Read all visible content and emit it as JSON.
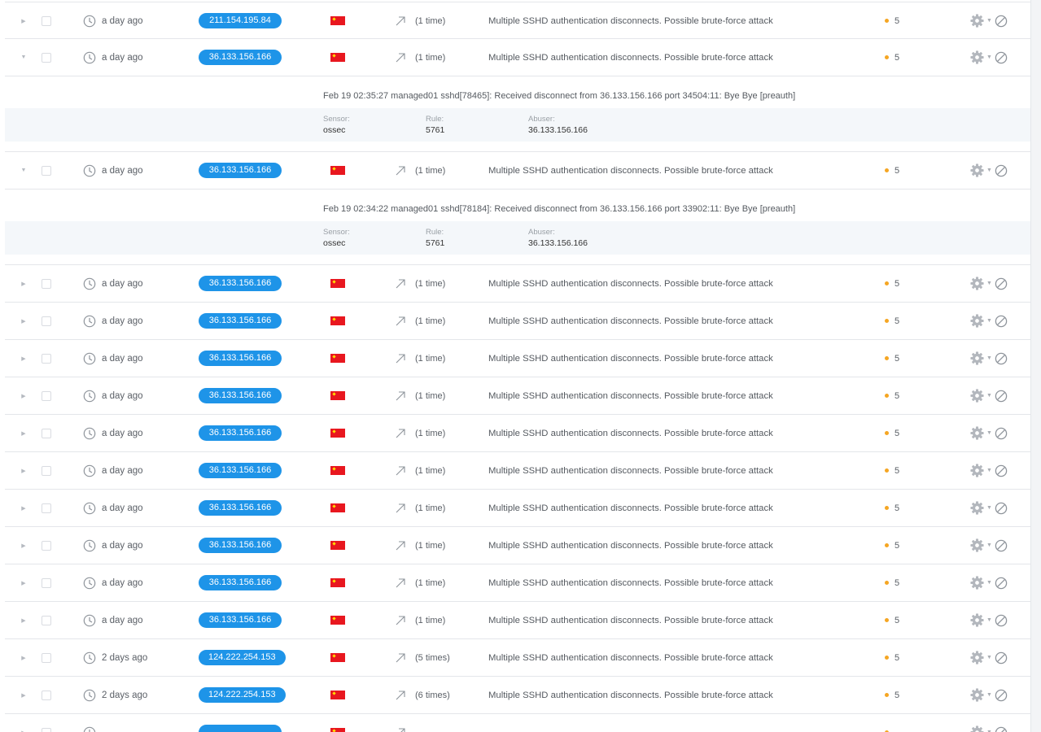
{
  "table": {
    "rows": [
      {
        "expanded": false,
        "time": "a day ago",
        "ip": "211.154.195.84",
        "count": "(1 time)",
        "description": "Multiple SSHD authentication disconnects. Possible brute-force attack",
        "risk": "5"
      },
      {
        "expanded": true,
        "time": "a day ago",
        "ip": "36.133.156.166",
        "count": "(1 time)",
        "description": "Multiple SSHD authentication disconnects. Possible brute-force attack",
        "risk": "5",
        "detail": {
          "raw": "Feb 19 02:35:27 managed01 sshd[78465]: Received disconnect from 36.133.156.166 port 34504:11: Bye Bye [preauth]",
          "sensor_label": "Sensor:",
          "sensor": "ossec",
          "rule_label": "Rule:",
          "rule": "5761",
          "abuser_label": "Abuser:",
          "abuser": "36.133.156.166"
        }
      },
      {
        "expanded": true,
        "time": "a day ago",
        "ip": "36.133.156.166",
        "count": "(1 time)",
        "description": "Multiple SSHD authentication disconnects. Possible brute-force attack",
        "risk": "5",
        "detail": {
          "raw": "Feb 19 02:34:22 managed01 sshd[78184]: Received disconnect from 36.133.156.166 port 33902:11: Bye Bye [preauth]",
          "sensor_label": "Sensor:",
          "sensor": "ossec",
          "rule_label": "Rule:",
          "rule": "5761",
          "abuser_label": "Abuser:",
          "abuser": "36.133.156.166"
        }
      },
      {
        "expanded": false,
        "time": "a day ago",
        "ip": "36.133.156.166",
        "count": "(1 time)",
        "description": "Multiple SSHD authentication disconnects. Possible brute-force attack",
        "risk": "5"
      },
      {
        "expanded": false,
        "time": "a day ago",
        "ip": "36.133.156.166",
        "count": "(1 time)",
        "description": "Multiple SSHD authentication disconnects. Possible brute-force attack",
        "risk": "5"
      },
      {
        "expanded": false,
        "time": "a day ago",
        "ip": "36.133.156.166",
        "count": "(1 time)",
        "description": "Multiple SSHD authentication disconnects. Possible brute-force attack",
        "risk": "5"
      },
      {
        "expanded": false,
        "time": "a day ago",
        "ip": "36.133.156.166",
        "count": "(1 time)",
        "description": "Multiple SSHD authentication disconnects. Possible brute-force attack",
        "risk": "5"
      },
      {
        "expanded": false,
        "time": "a day ago",
        "ip": "36.133.156.166",
        "count": "(1 time)",
        "description": "Multiple SSHD authentication disconnects. Possible brute-force attack",
        "risk": "5"
      },
      {
        "expanded": false,
        "time": "a day ago",
        "ip": "36.133.156.166",
        "count": "(1 time)",
        "description": "Multiple SSHD authentication disconnects. Possible brute-force attack",
        "risk": "5"
      },
      {
        "expanded": false,
        "time": "a day ago",
        "ip": "36.133.156.166",
        "count": "(1 time)",
        "description": "Multiple SSHD authentication disconnects. Possible brute-force attack",
        "risk": "5"
      },
      {
        "expanded": false,
        "time": "a day ago",
        "ip": "36.133.156.166",
        "count": "(1 time)",
        "description": "Multiple SSHD authentication disconnects. Possible brute-force attack",
        "risk": "5"
      },
      {
        "expanded": false,
        "time": "a day ago",
        "ip": "36.133.156.166",
        "count": "(1 time)",
        "description": "Multiple SSHD authentication disconnects. Possible brute-force attack",
        "risk": "5"
      },
      {
        "expanded": false,
        "time": "a day ago",
        "ip": "36.133.156.166",
        "count": "(1 time)",
        "description": "Multiple SSHD authentication disconnects. Possible brute-force attack",
        "risk": "5"
      },
      {
        "expanded": false,
        "time": "2 days ago",
        "ip": "124.222.254.153",
        "count": "(5 times)",
        "description": "Multiple SSHD authentication disconnects. Possible brute-force attack",
        "risk": "5"
      },
      {
        "expanded": false,
        "time": "2 days ago",
        "ip": "124.222.254.153",
        "count": "(6 times)",
        "description": "Multiple SSHD authentication disconnects. Possible brute-force attack",
        "risk": "5"
      },
      {
        "expanded": false,
        "time": "",
        "ip": "",
        "count": "",
        "description": "",
        "risk": ""
      }
    ]
  },
  "icons": {
    "expand_collapsed": "caret-right-icon",
    "expand_open": "caret-down-icon",
    "time": "clock-icon",
    "flag": "china-flag-icon",
    "count": "arrow-up-right-icon",
    "risk": "risk-dot-icon",
    "actions": "gear-icon",
    "block": "ban-icon"
  },
  "colors": {
    "ip_badge": "#1e94e8",
    "risk_dot": "#f5a623",
    "flag_red": "#e8171f",
    "detail_bg": "#f4f7fa"
  }
}
